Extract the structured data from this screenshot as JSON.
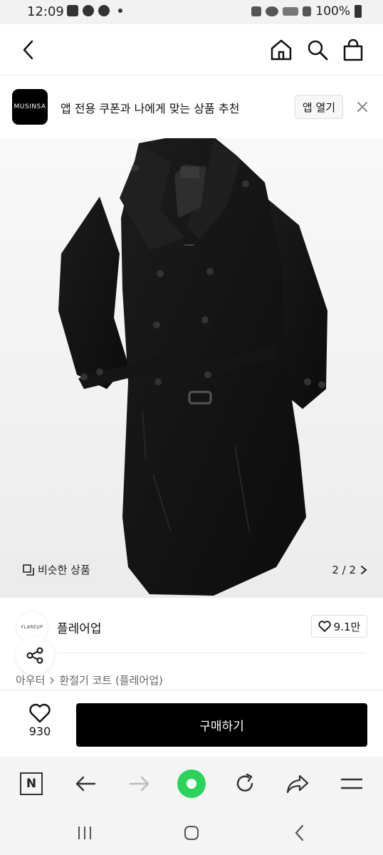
{
  "status_bar": {
    "time": "12:09",
    "battery": "100%"
  },
  "banner": {
    "logo_text": "MUSINSA",
    "text": "앱 전용 쿠폰과 나에게 맞는 상품 추천",
    "open_label": "앱 열기"
  },
  "product_label": "FLAREUP",
  "image_overlay": {
    "similar_label": "비슷한 상품",
    "page_counter": "2 / 2"
  },
  "brand": {
    "logo_text": "FLAREUP",
    "name": "플레어업",
    "likes": "9.1만"
  },
  "breadcrumb": {
    "category": "아우터",
    "item": "환절기 코트 (플레어업)"
  },
  "action_bar": {
    "wish_count": "930",
    "buy_label": "구매하기"
  },
  "icons": {
    "back": "chevron-left-icon",
    "home": "home-icon",
    "search": "search-icon",
    "bag": "shopping-bag-icon",
    "close": "close-icon",
    "similar": "copy-icon",
    "heart": "heart-icon",
    "share": "share-icon"
  },
  "colors": {
    "buy_button": "#000000",
    "browser_green": "#2bd35a"
  }
}
